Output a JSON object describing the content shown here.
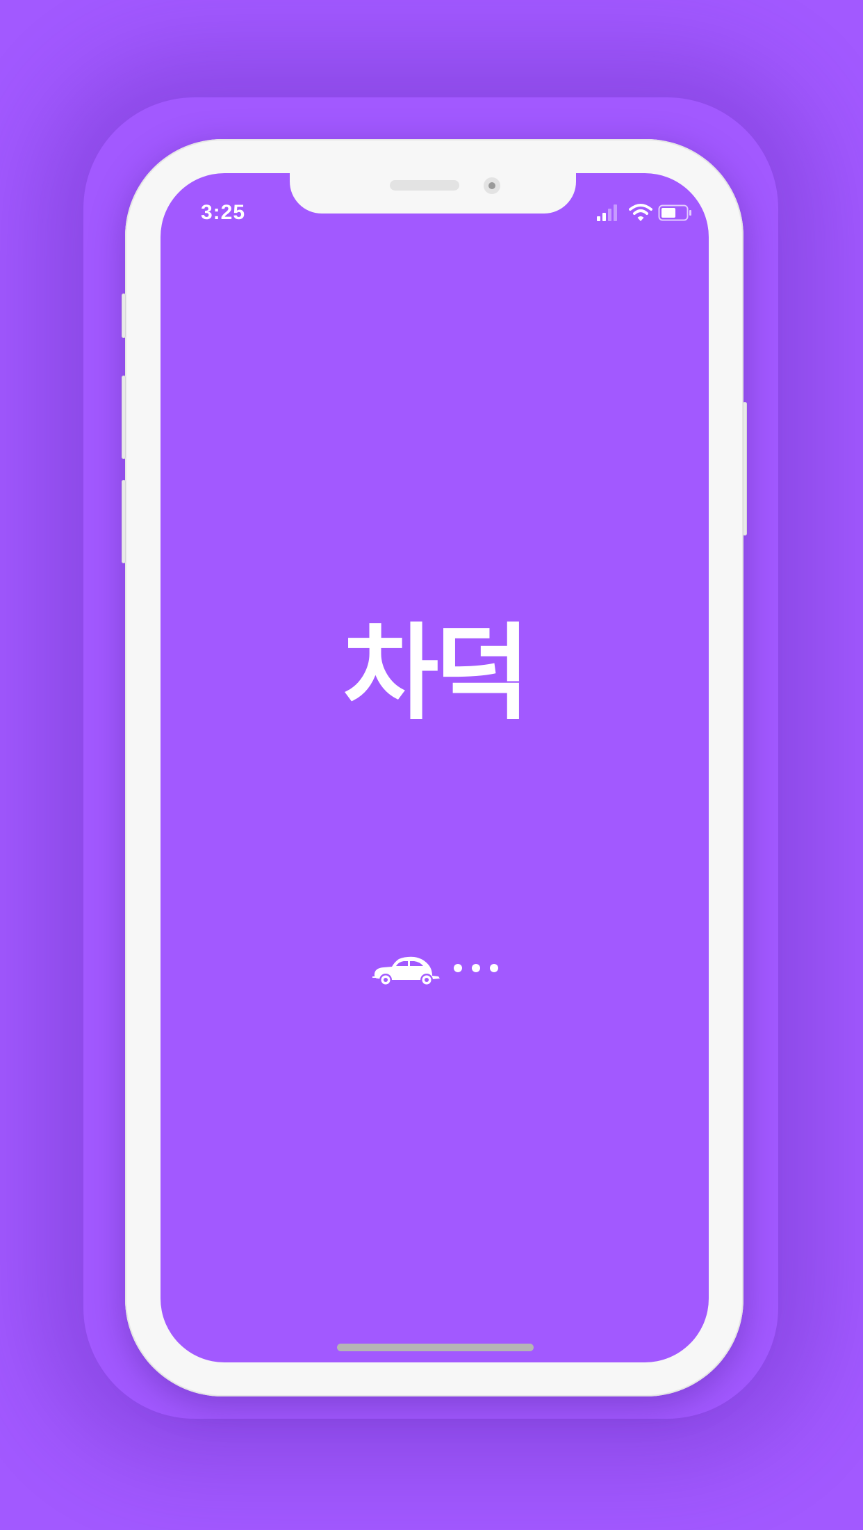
{
  "status_bar": {
    "time": "3:25",
    "signal_icon": "cellular-signal-icon",
    "wifi_icon": "wifi-icon",
    "battery_icon": "battery-icon"
  },
  "splash": {
    "app_name": "차덕",
    "loading_icon": "car-icon"
  },
  "colors": {
    "background": "#a259ff",
    "phone_frame": "#f7f7f7",
    "text": "#ffffff"
  }
}
